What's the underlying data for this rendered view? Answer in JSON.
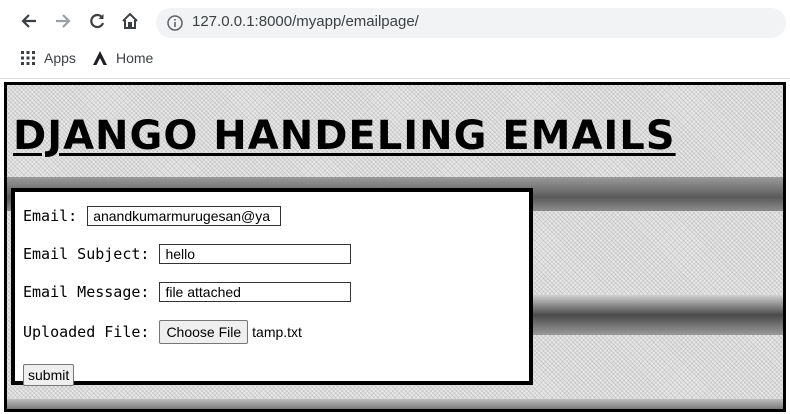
{
  "browser": {
    "url": "127.0.0.1:8000/myapp/emailpage/",
    "bookmarks": [
      {
        "label": "Apps",
        "icon": "apps-grid-icon"
      },
      {
        "label": "Home",
        "icon": "home-logo-icon"
      }
    ]
  },
  "page": {
    "title": "DJANGO HANDELING EMAILS"
  },
  "form": {
    "email_label": "Email:",
    "email_value": "anandkumarmurugesan@ya",
    "subject_label": "Email Subject:",
    "subject_value": "hello",
    "message_label": "Email Message:",
    "message_value": "file attached",
    "file_label": "Uploaded File:",
    "file_button": "Choose File",
    "file_name": "tamp.txt",
    "submit_label": "submit"
  }
}
